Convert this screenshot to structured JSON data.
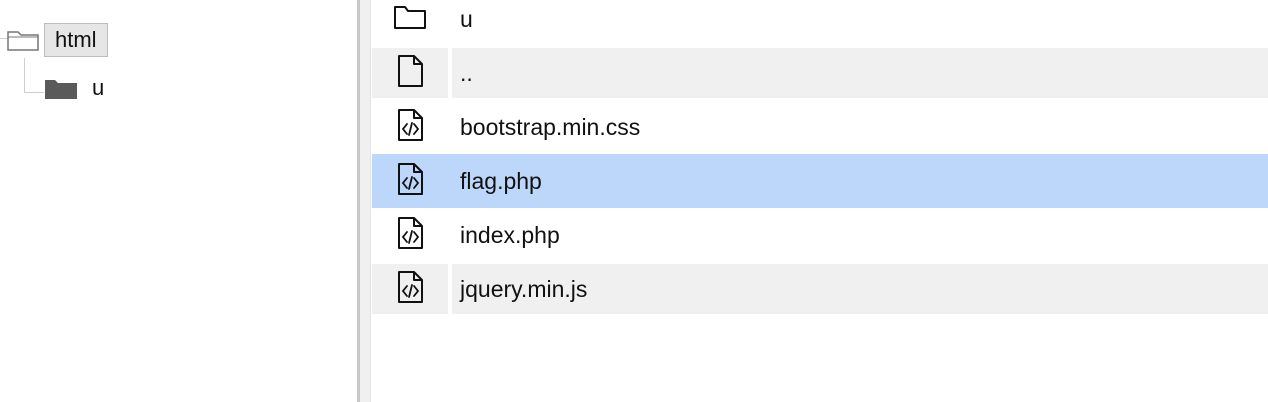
{
  "tree": {
    "root": {
      "label": "html",
      "icon": "folder-open-icon",
      "selected": true
    },
    "children": [
      {
        "label": "u",
        "icon": "folder-closed-icon"
      }
    ]
  },
  "files": {
    "rows": [
      {
        "name": "u",
        "icon": "folder-icon",
        "style": "plain"
      },
      {
        "name": "..",
        "icon": "file-icon",
        "style": "shaded"
      },
      {
        "name": "bootstrap.min.css",
        "icon": "code-file-icon",
        "style": "plain"
      },
      {
        "name": "flag.php",
        "icon": "code-file-icon",
        "style": "selected"
      },
      {
        "name": "index.php",
        "icon": "code-file-icon",
        "style": "plain"
      },
      {
        "name": "jquery.min.js",
        "icon": "code-file-icon",
        "style": "shaded"
      }
    ]
  },
  "colors": {
    "selected_row": "#bdd7fa",
    "shaded_row": "#f0f0f0",
    "tree_selected_bg": "#e6e6e6",
    "splitter": "#c8c8c8"
  }
}
